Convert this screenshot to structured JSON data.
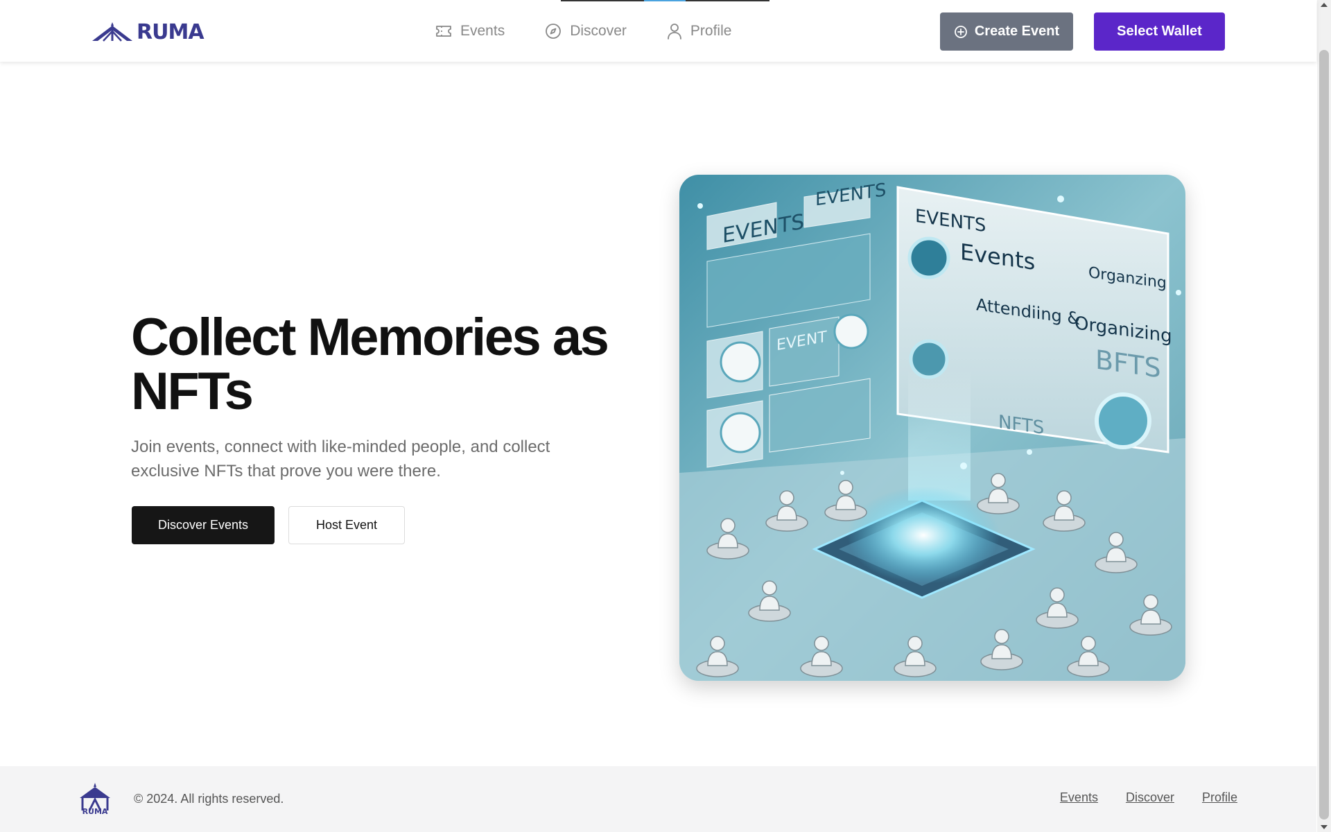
{
  "header": {
    "logo_text": "RUMA",
    "nav": [
      {
        "label": "Events",
        "icon": "ticket-icon"
      },
      {
        "label": "Discover",
        "icon": "compass-icon"
      },
      {
        "label": "Profile",
        "icon": "user-icon"
      }
    ],
    "create_event_label": "Create Event",
    "select_wallet_label": "Select Wallet"
  },
  "hero": {
    "title": "Collect Memories as NFTs",
    "subtitle": "Join events, connect with like-minded people, and collect exclusive NFTs that prove you were there.",
    "primary_button": "Discover Events",
    "secondary_button": "Host Event",
    "image_text": {
      "events_banner": "EVENTS",
      "events_title": "Events",
      "organizing": "Organzing",
      "attending": "Attendiing &",
      "organizing_2": "Organizing",
      "bfts": "BFTS",
      "nfts": "NFTS",
      "event": "EVENT"
    }
  },
  "footer": {
    "copyright": "© 2024. All rights reserved.",
    "links": [
      "Events",
      "Discover",
      "Profile"
    ]
  },
  "colors": {
    "brand": "#3a3a8f",
    "wallet_button": "#5b26c9",
    "create_button": "#6b7280",
    "primary_button": "#161616",
    "footer_bg": "#f4f4f5"
  }
}
